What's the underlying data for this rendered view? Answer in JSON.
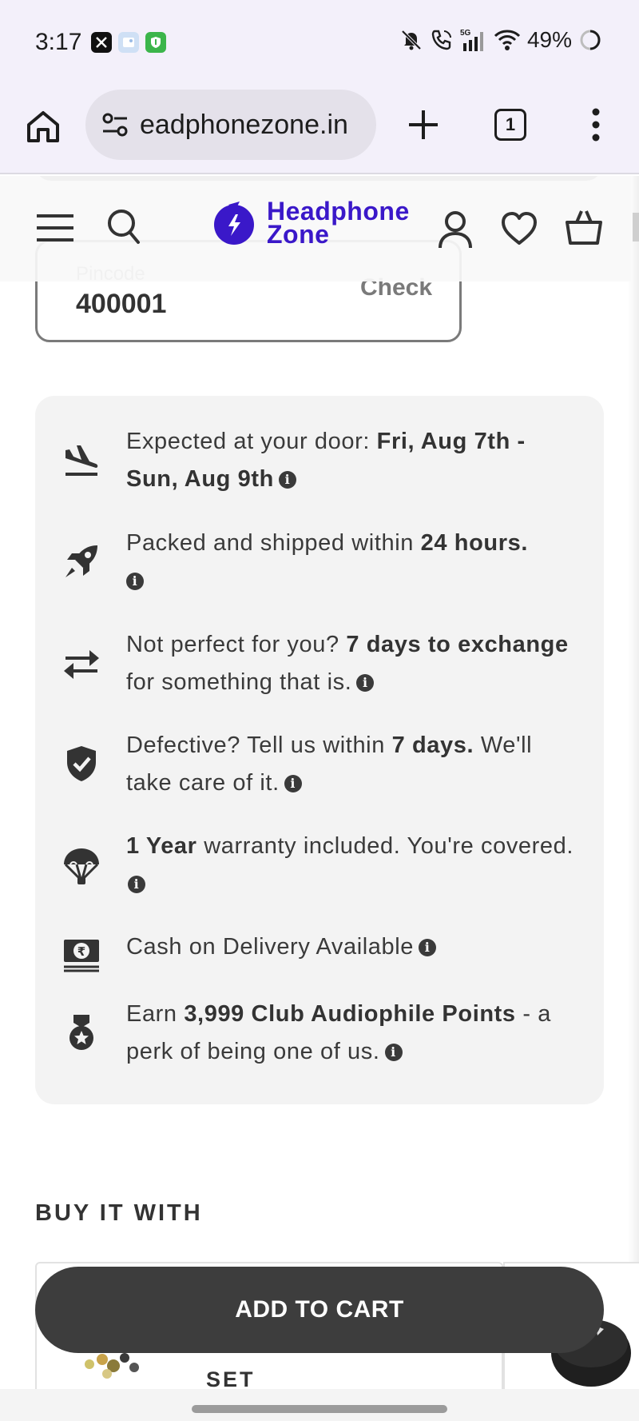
{
  "status_bar": {
    "time": "3:17",
    "battery": "49%",
    "network": "5G",
    "icons": [
      "x-app-icon",
      "gallery-app-icon",
      "vpn-app-icon",
      "mute-icon",
      "wifi-call-icon",
      "signal-icon",
      "wifi-icon",
      "battery-saver-icon"
    ]
  },
  "browser": {
    "url": "eadphonezone.in",
    "tab_count": "1"
  },
  "site": {
    "logo_line1": "Headphone",
    "logo_line2": "Zone",
    "brand_color": "#3a18c9"
  },
  "pincode": {
    "label": "Pincode",
    "value": "400001",
    "check_label": "Check"
  },
  "info_rows": {
    "delivery": {
      "pre": "Expected at your door: ",
      "bold": "Fri, Aug 7th - Sun, Aug 9th",
      "post": ""
    },
    "shipping": {
      "pre": "Packed and shipped within ",
      "bold": "24 hours.",
      "post": ""
    },
    "exchange": {
      "pre": "Not perfect for you? ",
      "bold": "7 days to exchange",
      "post": " for something that is."
    },
    "defective": {
      "pre": "Defective? Tell us within ",
      "bold": "7 days.",
      "post": " We'll take care of it."
    },
    "warranty": {
      "pre": "",
      "bold": "1 Year",
      "post": " warranty included. You're covered."
    },
    "cod": {
      "pre": "Cash on Delivery Available",
      "bold": "",
      "post": ""
    },
    "points": {
      "pre": "Earn ",
      "bold": "3,999 Club Audiophile Points",
      "post": " - a perk of being one of us."
    },
    "info_glyph": "i"
  },
  "buy_it_with": {
    "heading": "BUY IT WITH",
    "product_title_fragment": "SET"
  },
  "add_to_cart": "ADD TO CART"
}
